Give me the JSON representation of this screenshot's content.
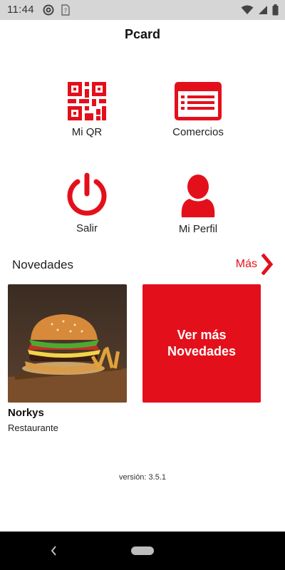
{
  "status_bar": {
    "time": "11:44",
    "left_icons": [
      "at-sign-icon",
      "no-sim-icon"
    ],
    "right_icons": [
      "wifi-icon",
      "signal-icon",
      "battery-icon"
    ]
  },
  "header": {
    "title": "Pcard"
  },
  "menu": {
    "items": [
      {
        "label": "Mi QR",
        "icon": "qr-code-icon"
      },
      {
        "label": "Comercios",
        "icon": "store-list-icon"
      },
      {
        "label": "Salir",
        "icon": "power-icon"
      },
      {
        "label": "Mi Perfil",
        "icon": "user-icon"
      }
    ]
  },
  "news": {
    "title": "Novedades",
    "more_label": "Más",
    "cards": [
      {
        "name": "Norkys",
        "type": "Restaurante",
        "image": "burger-photo"
      }
    ],
    "more_card_text": "Ver más\nNovedades"
  },
  "footer": {
    "version": "versión: 3.5.1"
  },
  "colors": {
    "accent": "#e3101b",
    "status_bar": "#d6d6d6",
    "nav_bar": "#000000"
  }
}
